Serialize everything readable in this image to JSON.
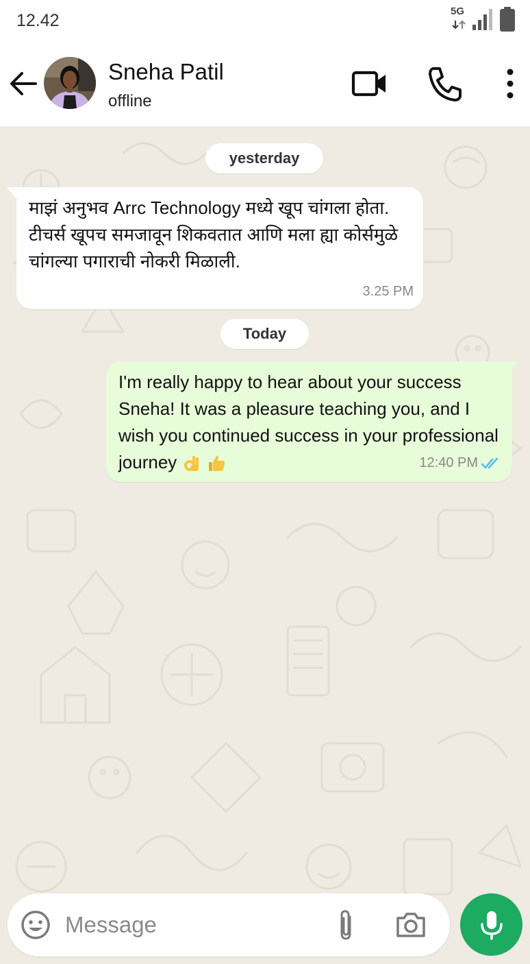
{
  "status_bar": {
    "time": "12.42",
    "network": "5G"
  },
  "header": {
    "contact_name": "Sneha Patil",
    "contact_status": "offline",
    "icons": {
      "back": "arrow-left-icon",
      "video": "video-call-icon",
      "call": "phone-icon",
      "menu": "more-vertical-icon"
    }
  },
  "chat": {
    "date_chips": [
      "yesterday",
      "Today"
    ],
    "messages": [
      {
        "direction": "incoming",
        "text": "माझं अनुभव Arrc Technology मध्ये खूप चांगला होता. टीचर्स खूपच समजावून शिकवतात आणि मला ह्या कोर्समुळे चांगल्या पगाराची नोकरी मिळाली.",
        "time": "3.25 PM"
      },
      {
        "direction": "outgoing",
        "text": "I'm really happy to hear about your success Sneha! It was a pleasure teaching you, and I wish you continued success in your professional journey",
        "emojis": [
          "ok-hand-emoji",
          "thumbs-up-emoji"
        ],
        "time": "12:40 PM",
        "status": "read"
      }
    ]
  },
  "composer": {
    "placeholder": "Message",
    "value": ""
  },
  "colors": {
    "chat_background": "#efeae2",
    "outgoing_bubble": "#e7fcd9",
    "incoming_bubble": "#ffffff",
    "mic_button": "#1daa61",
    "read_ticks": "#53bdeb"
  }
}
